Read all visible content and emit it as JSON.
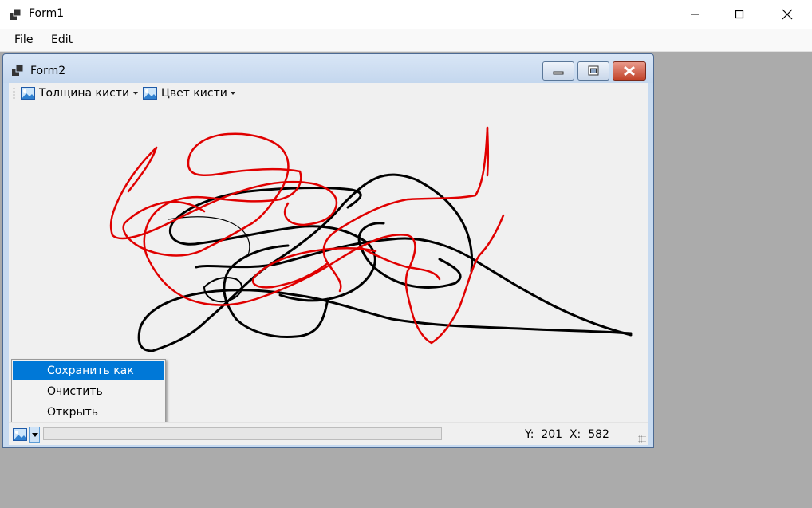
{
  "form1": {
    "title": "Form1",
    "menu": {
      "file": "File",
      "edit": "Edit"
    }
  },
  "form2": {
    "title": "Form2",
    "toolbar": {
      "brush_width": "Толщина кисти",
      "brush_color": "Цвет кисти"
    },
    "context_menu": {
      "items": [
        "Сохранить как",
        "Очистить",
        "Открыть"
      ],
      "selected_index": 0
    },
    "status": {
      "y_label": "Y:",
      "y_value": "201",
      "x_label": "X:",
      "x_value": "582",
      "progress": 0
    }
  },
  "colors": {
    "mdi_background": "#ababab",
    "stroke_black": "#000000",
    "stroke_red": "#e00000",
    "selection": "#0078d7"
  },
  "icons": [
    "app-icon",
    "minimize-icon",
    "maximize-icon",
    "close-icon",
    "image-icon",
    "dropdown-arrow-icon",
    "size-grip-icon"
  ]
}
